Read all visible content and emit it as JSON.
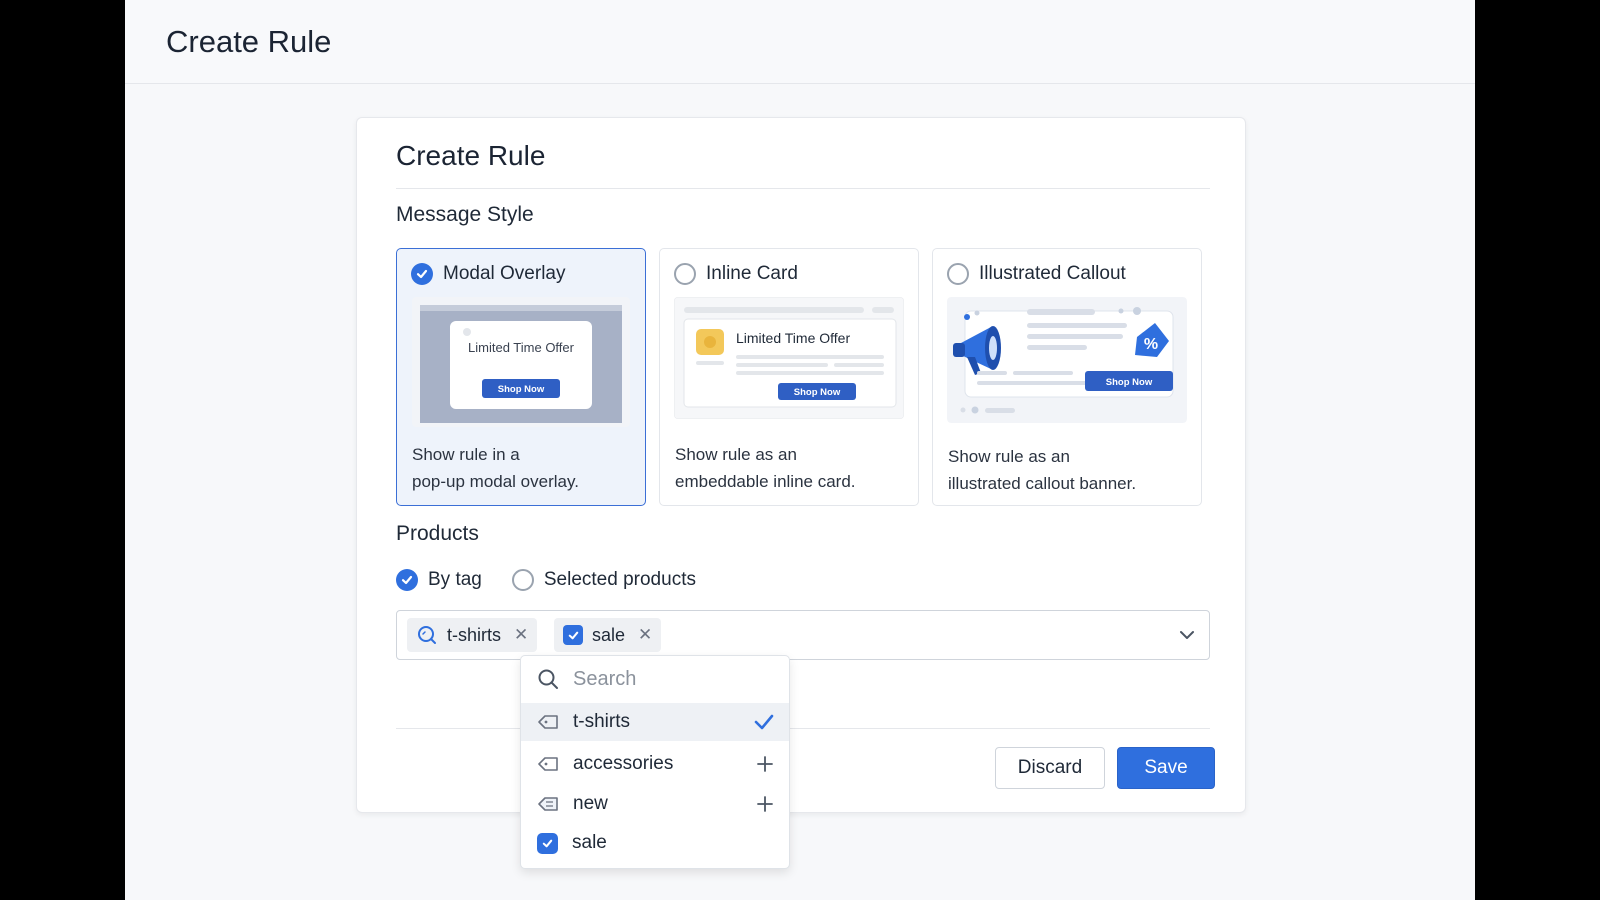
{
  "header": {
    "title": "Create Rule"
  },
  "card": {
    "title": "Create Rule",
    "message_style_label": "Message Style",
    "styles": [
      {
        "label": "Modal Overlay",
        "desc1": "Show rule in a",
        "desc2": "pop-up modal overlay.",
        "thumb_title": "Limited Time Offer",
        "thumb_button": "Shop Now"
      },
      {
        "label": "Inline Card",
        "desc1": "Show rule as an",
        "desc2": "embeddable inline card.",
        "thumb_title": "Limited Time Offer",
        "thumb_button": "Shop Now"
      },
      {
        "label": "Illustrated Callout",
        "desc1": "Show rule as an",
        "desc2": "illustrated callout banner.",
        "thumb_button": "Shop Now",
        "thumb_symbol": "%"
      }
    ],
    "products_label": "Products",
    "product_modes": [
      {
        "label": "By tag"
      },
      {
        "label": "Selected products"
      }
    ],
    "selected_tags": [
      {
        "label": "t-shirts"
      },
      {
        "label": "sale"
      }
    ],
    "discard_label": "Discard",
    "save_label": "Save"
  },
  "dropdown": {
    "search_placeholder": "Search",
    "items": [
      {
        "label": "t-shirts"
      },
      {
        "label": "accessories"
      },
      {
        "label": "new"
      },
      {
        "label": "sale"
      }
    ]
  },
  "colors": {
    "accent": "#2f6fde",
    "selected_bg": "#eef3fb"
  }
}
